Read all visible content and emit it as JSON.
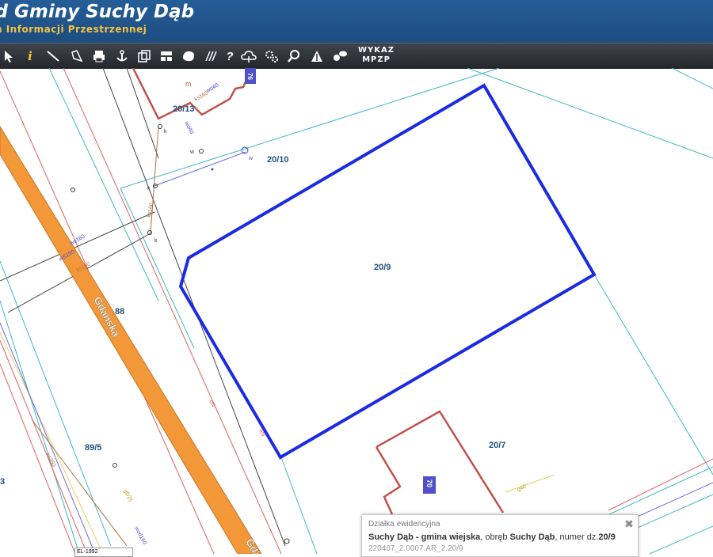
{
  "header": {
    "title": "ąd Gminy Suchy Dąb",
    "subtitle": "n Informacji Przestrzennej"
  },
  "toolbar": {
    "tools": [
      "pointer-tool-icon",
      "info-tool-icon",
      "measure-line-icon",
      "measure-area-icon",
      "print-icon",
      "anchor-icon",
      "copy-icon",
      "layout-icon",
      "shape-icon",
      "hatch-icon",
      "help-icon",
      "cloud-icon",
      "settings-icon",
      "zoom-icon",
      "road-sign-icon",
      "chat-icon"
    ],
    "wykaz_line1": "WYKAZ",
    "wykaz_line2": "MPZP"
  },
  "map": {
    "parcels": [
      "20/13",
      "20/10",
      "20/9",
      "20/7",
      "89/5",
      "88"
    ],
    "street": "Gdańska",
    "street_tail": "Gda",
    "edge_numbers": [
      "3"
    ],
    "building_number_top": "76",
    "building_number_bottom": "70",
    "utility_labels": [
      "ks160",
      "wd40",
      "w",
      "k",
      "m",
      "wS150",
      "ks250",
      "ks160",
      "gD25",
      "wod160",
      "eN",
      "g40",
      "eN",
      "k",
      "wd40",
      "ws160",
      "ks160",
      "w",
      "k"
    ],
    "colors": {
      "selected_parcel": "#1c2be3",
      "parcel_lines": "#3fb7c4",
      "road": "#f39838",
      "building": "#c0514d",
      "label": "#24507d"
    }
  },
  "popup": {
    "title": "Działka ewidencyjna",
    "gmina": "Suchy Dąb - gmina wiejska",
    "obreb_prefix": ", obręb ",
    "obreb": "Suchy Dąb",
    "numer_prefix": ", numer dz.",
    "numer": "20/9",
    "details": "220407_2.0007.AR_2.20/9"
  },
  "crs_select": "EL-1992"
}
